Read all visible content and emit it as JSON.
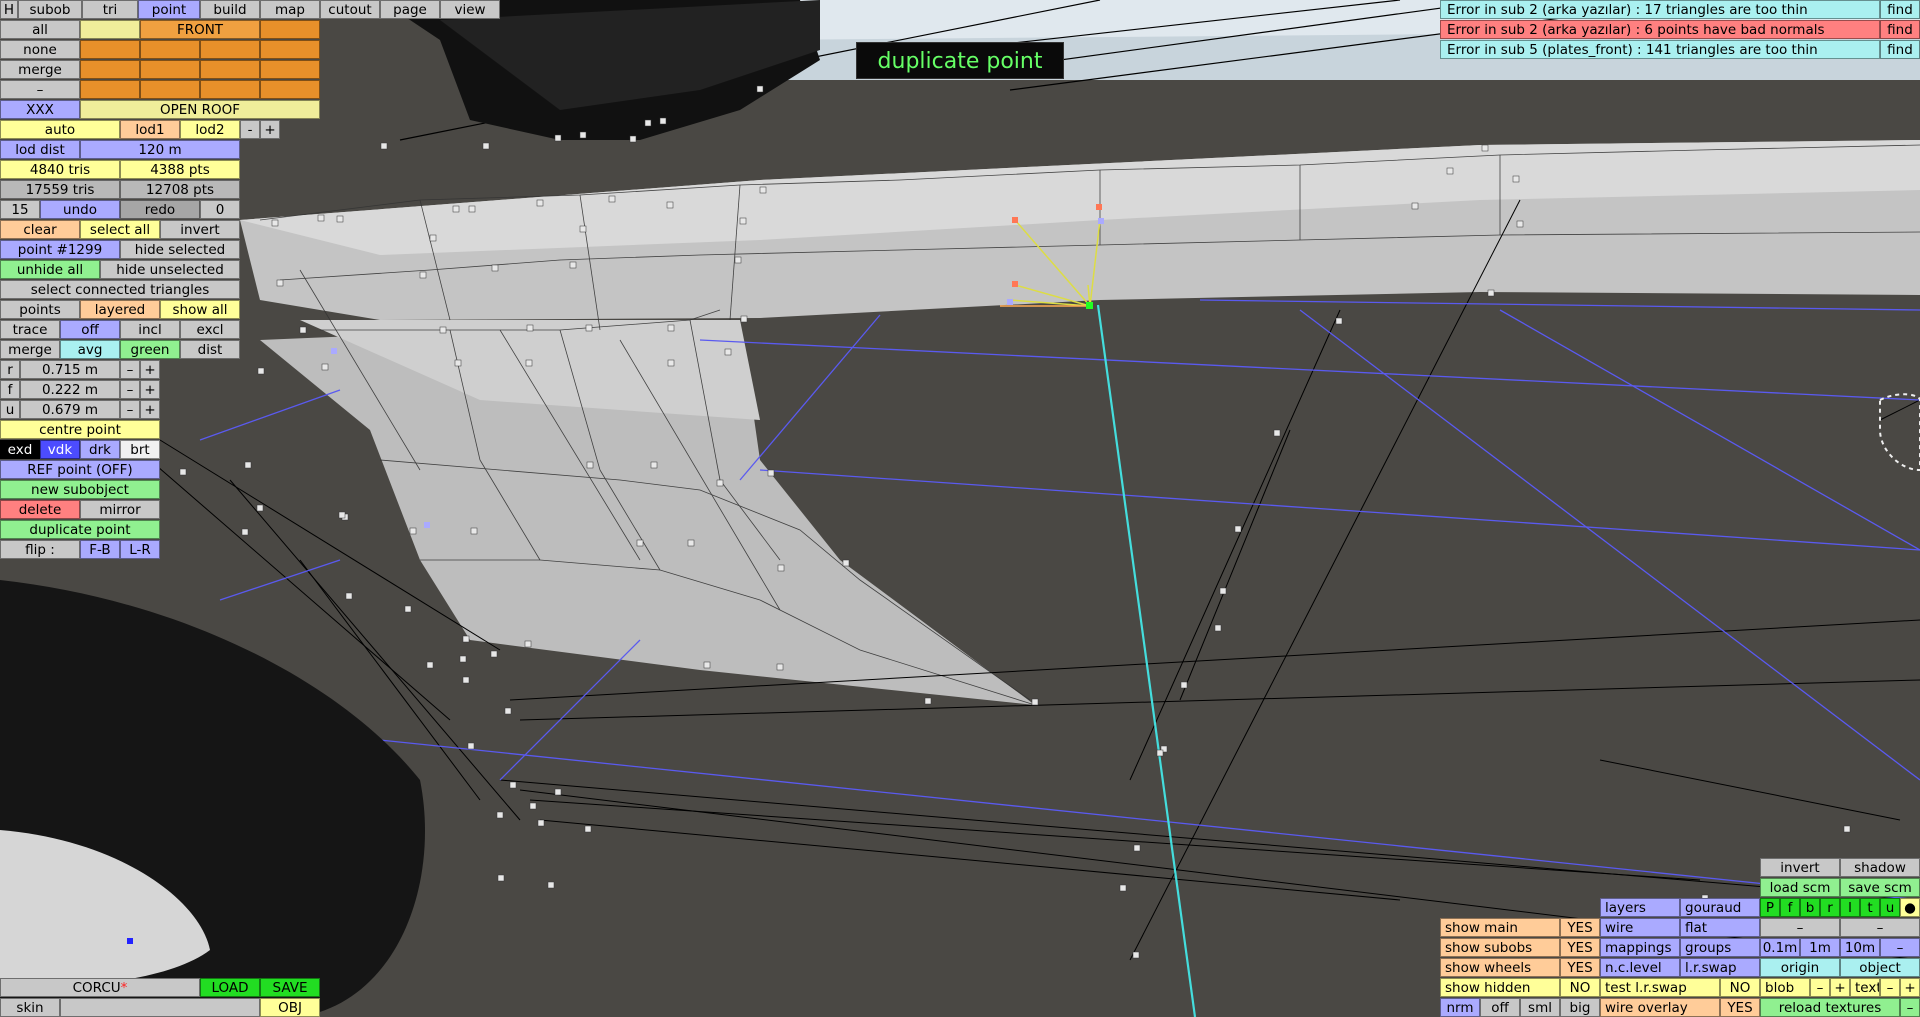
{
  "colors": {
    "orange": "#e8902a",
    "yellow": "#ffff99",
    "blue": "#aaaaff",
    "green": "#90f090",
    "red": "#ff8080",
    "cyan": "#aaf0f0"
  },
  "menu": [
    "H",
    "subob",
    "tri",
    "point",
    "build",
    "map",
    "cutout",
    "page",
    "view"
  ],
  "select": {
    "all": "all",
    "none": "none",
    "merge": "merge",
    "dash": "–",
    "xxx": "XXX",
    "front": "FRONT",
    "open_roof": "OPEN ROOF"
  },
  "lod": {
    "auto": "auto",
    "lod1": "lod1",
    "lod2": "lod2",
    "minus": "-",
    "plus": "+",
    "dist_label": "lod dist",
    "dist_value": "120 m"
  },
  "stats": {
    "tris1": "4840 tris",
    "pts1": "4388 pts",
    "tris2": "17559 tris",
    "pts2": "12708 pts"
  },
  "history": {
    "count": "15",
    "undo": "undo",
    "redo": "redo",
    "redo_count": "0"
  },
  "sel_ops": {
    "clear": "clear",
    "select_all": "select all",
    "invert": "invert",
    "point_id": "point #1299",
    "hide_selected": "hide selected",
    "unhide_all": "unhide all",
    "hide_unselected": "hide unselected",
    "select_connected": "select connected triangles"
  },
  "display": {
    "points": "points",
    "layered": "layered",
    "show_all": "show all"
  },
  "trace": {
    "label": "trace",
    "off": "off",
    "incl": "incl",
    "excl": "excl"
  },
  "merge_row": {
    "merge": "merge",
    "avg": "avg",
    "green": "green",
    "dist": "dist"
  },
  "coords": [
    {
      "axis": "r",
      "value": "0.715 m"
    },
    {
      "axis": "f",
      "value": "0.222 m"
    },
    {
      "axis": "u",
      "value": "0.679 m"
    }
  ],
  "step": {
    "minus": "–",
    "plus": "+"
  },
  "point_ops": {
    "centre": "centre point",
    "exd": "exd",
    "vdk": "vdk",
    "drk": "drk",
    "brt": "brt",
    "ref": "REF point (OFF)",
    "new_subobject": "new subobject",
    "delete": "delete",
    "mirror": "mirror",
    "duplicate": "duplicate point",
    "flip_label": "flip :",
    "fb": "F-B",
    "lr": "L-R"
  },
  "errors": [
    {
      "text": "Error in sub 2 (arka yazılar) : 17 triangles are too thin",
      "find": "find"
    },
    {
      "text": "Error in sub 2 (arka yazılar) : 6 points have bad normals",
      "find": "find"
    },
    {
      "text": "Error in sub 5 (plates_front) : 141 triangles are too thin",
      "find": "find"
    }
  ],
  "toast": "duplicate point",
  "file": {
    "name": "CORCU",
    "star": "*",
    "load": "LOAD",
    "save": "SAVE",
    "skin": "skin",
    "obj": "OBJ"
  },
  "right_panel": {
    "invert": "invert",
    "shadow": "shadow",
    "load_scm": "load scm",
    "save_scm": "save scm",
    "layers": "layers",
    "gouraud": "gouraud",
    "wire": "wire",
    "flat": "flat",
    "mappings": "mappings",
    "groups": "groups",
    "nc_level": "n.c.level",
    "lr_swap": "l.r.swap",
    "test_lr_swap": "test l.r.swap",
    "no": "NO",
    "wire_overlay": "wire overlay",
    "yes": "YES",
    "show_main": "show main",
    "show_subobs": "show subobs",
    "show_wheels": "show wheels",
    "show_hidden": "show hidden",
    "nrm": "nrm",
    "off": "off",
    "sml": "sml",
    "big": "big",
    "dash": "–",
    "m01": "0.1m",
    "m1": "1m",
    "m10": "10m",
    "origin": "origin",
    "object": "object",
    "blob": "blob",
    "text": "text",
    "minus": "–",
    "plus": "+",
    "reload_textures": "reload textures",
    "views": [
      "P",
      "f",
      "b",
      "r",
      "l",
      "t",
      "u"
    ],
    "dot": "●"
  }
}
